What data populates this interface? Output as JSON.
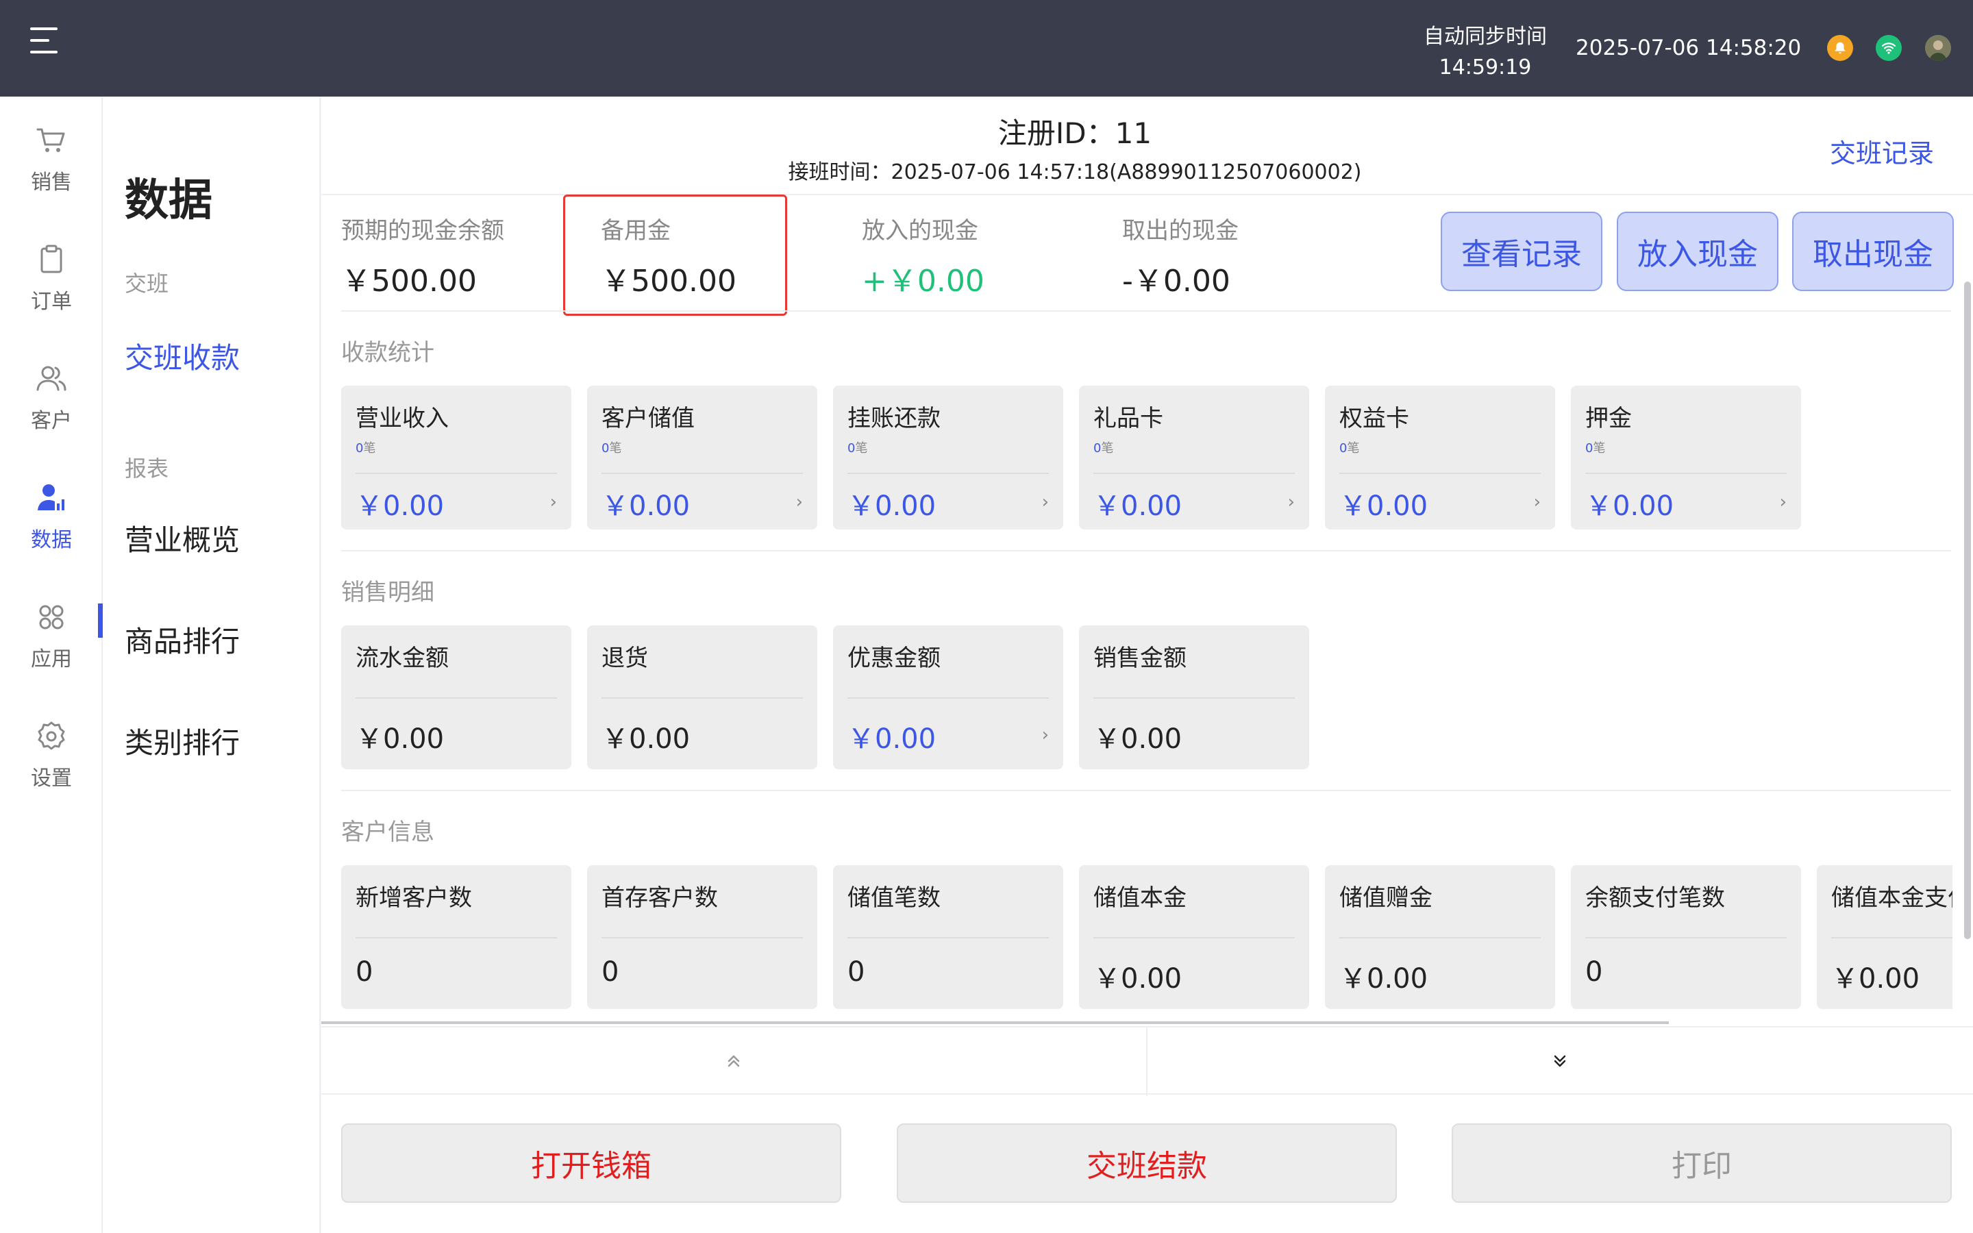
{
  "topbar": {
    "sync_label": "自动同步时间",
    "sync_time": "14:59:19",
    "datetime": "2025-07-06 14:58:20",
    "icons": [
      "menu-icon",
      "bell-icon",
      "wifi-icon",
      "avatar"
    ]
  },
  "nav": {
    "items": [
      {
        "label": "销售",
        "icon": "cart-icon"
      },
      {
        "label": "订单",
        "icon": "clipboard-icon"
      },
      {
        "label": "客户",
        "icon": "users-icon"
      },
      {
        "label": "数据",
        "icon": "user-chart-icon"
      },
      {
        "label": "应用",
        "icon": "apps-icon"
      },
      {
        "label": "设置",
        "icon": "gear-icon"
      }
    ],
    "active": "数据"
  },
  "submenu": {
    "title": "数据",
    "group1": "交班",
    "shift_pay": "交班收款",
    "group2": "报表",
    "overview": "营业概览",
    "product_rank": "商品排行",
    "category_rank": "类别排行"
  },
  "header": {
    "reg_id": "注册ID：11",
    "shift_time": "接班时间：2025-07-06 14:57:18(A88990112507060002)",
    "shift_records": "交班记录"
  },
  "cash": {
    "expected_label": "预期的现金余额",
    "expected_value": "￥500.00",
    "reserve_label": "备用金",
    "reserve_value": "￥500.00",
    "in_label": "放入的现金",
    "in_value": "+￥0.00",
    "out_label": "取出的现金",
    "out_value": "-￥0.00",
    "view_btn": "查看记录",
    "put_btn": "放入现金",
    "take_btn": "取出现金",
    "in_color": "#1fc17a"
  },
  "collect": {
    "title": "收款统计",
    "cards": [
      {
        "title": "营业收入",
        "count": "0",
        "unit": "笔",
        "value": "￥0.00"
      },
      {
        "title": "客户储值",
        "count": "0",
        "unit": "笔",
        "value": "￥0.00"
      },
      {
        "title": "挂账还款",
        "count": "0",
        "unit": "笔",
        "value": "￥0.00"
      },
      {
        "title": "礼品卡",
        "count": "0",
        "unit": "笔",
        "value": "￥0.00"
      },
      {
        "title": "权益卡",
        "count": "0",
        "unit": "笔",
        "value": "￥0.00"
      },
      {
        "title": "押金",
        "count": "0",
        "unit": "笔",
        "value": "￥0.00"
      }
    ]
  },
  "sales": {
    "title": "销售明细",
    "cards": [
      {
        "title": "流水金额",
        "value": "￥0.00"
      },
      {
        "title": "退货",
        "value": "￥0.00"
      },
      {
        "title": "优惠金额",
        "value": "￥0.00"
      },
      {
        "title": "销售金额",
        "value": "￥0.00"
      }
    ]
  },
  "customer": {
    "title": "客户信息",
    "cards": [
      {
        "title": "新增客户数",
        "value": "0"
      },
      {
        "title": "首存客户数",
        "value": "0"
      },
      {
        "title": "储值笔数",
        "value": "0"
      },
      {
        "title": "储值本金",
        "value": "￥0.00"
      },
      {
        "title": "储值赠金",
        "value": "￥0.00"
      },
      {
        "title": "余额支付笔数",
        "value": "0"
      },
      {
        "title": "储值本金支付",
        "value": "￥0.00"
      }
    ]
  },
  "pager": {
    "up": "chevron-up-double-icon",
    "down": "chevron-down-double-icon"
  },
  "bottom": {
    "open_drawer": "打开钱箱",
    "settle": "交班结款",
    "print": "打印",
    "action_color": "#e02020",
    "disabled_color": "#999999"
  }
}
